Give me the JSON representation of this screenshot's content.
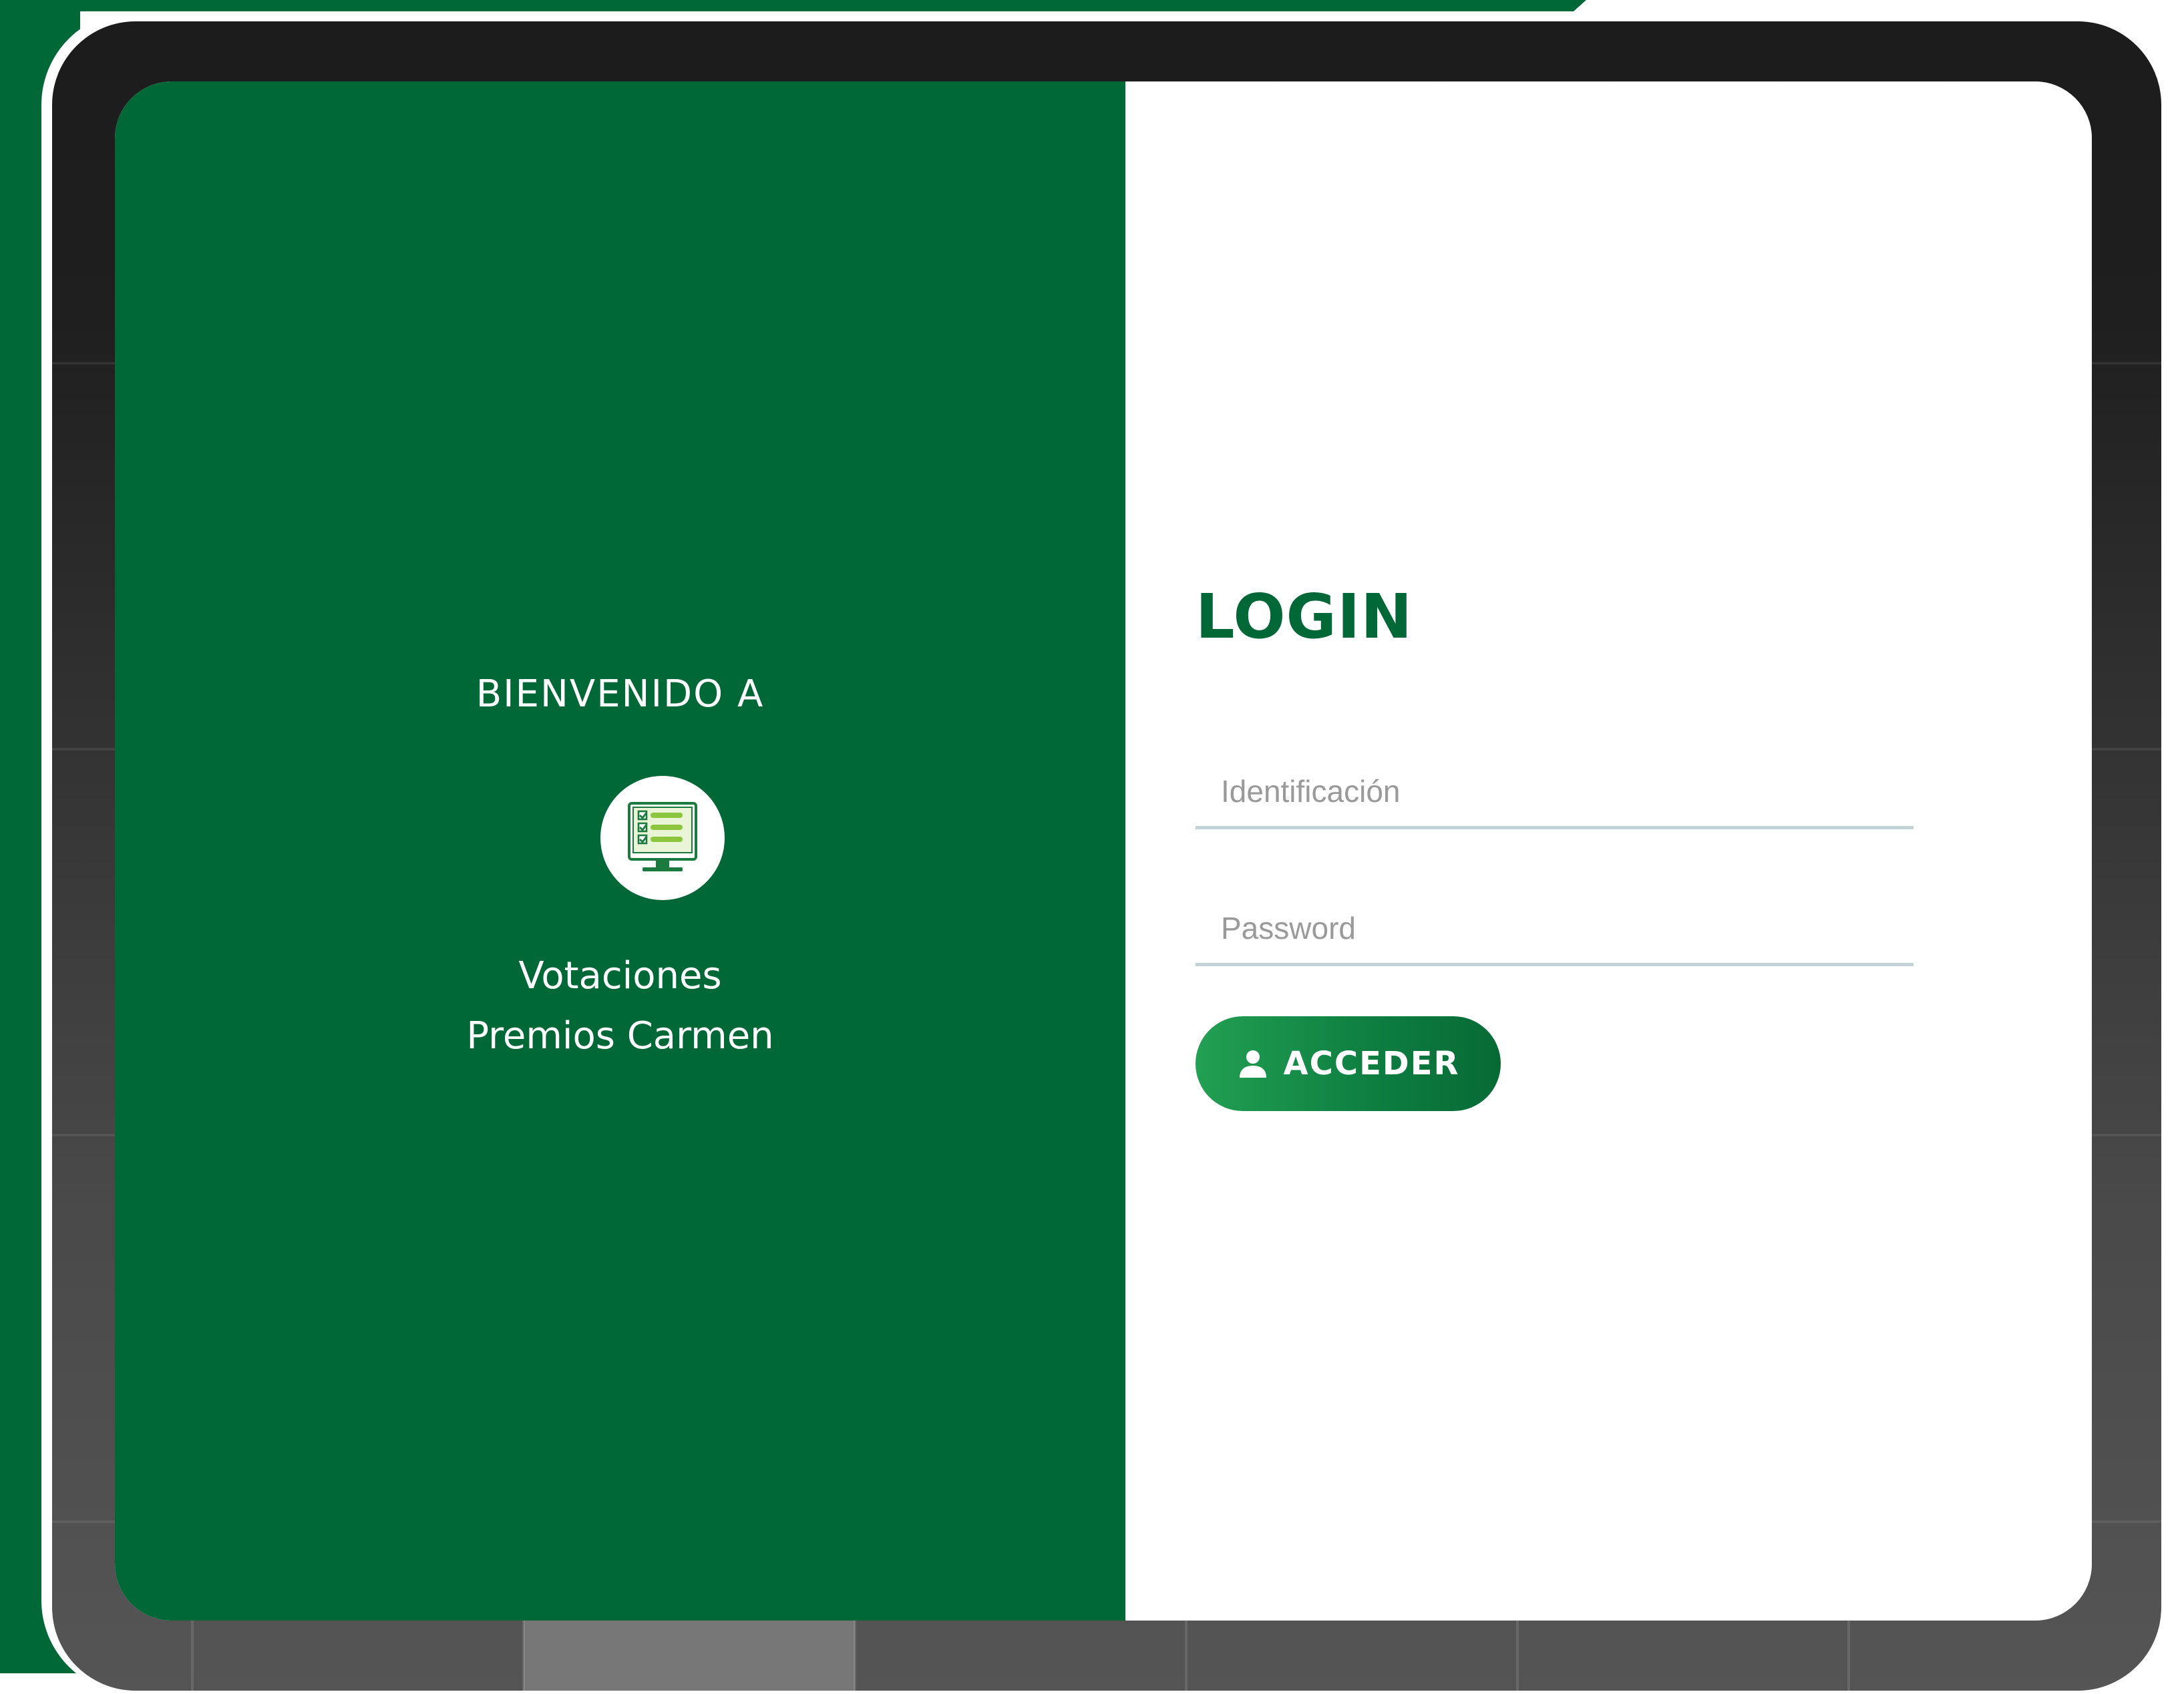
{
  "welcome": {
    "heading": "BIENVENIDO A",
    "logo_icon": "voting-computer-icon",
    "app_name_line1": "Votaciones",
    "app_name_line2": "Premios Carmen"
  },
  "login": {
    "title": "LOGIN",
    "id_placeholder": "Identificación",
    "password_placeholder": "Password",
    "button_label": "ACCEDER",
    "button_icon": "user-icon"
  },
  "colors": {
    "brand_green": "#006837",
    "button_gradient_start": "#22a053",
    "field_underline": "#c3d4d6"
  }
}
